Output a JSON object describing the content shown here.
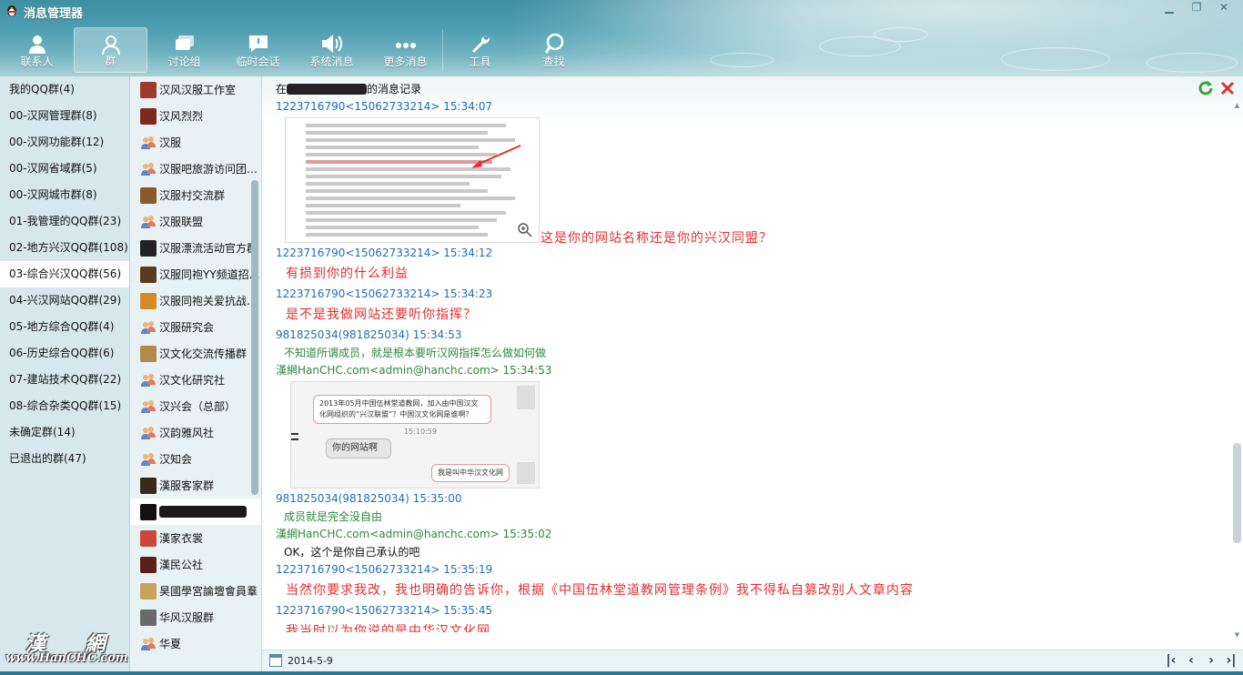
{
  "window": {
    "title": "消息管理器",
    "controls": [
      "minimize",
      "restore",
      "close"
    ]
  },
  "toolbar": [
    {
      "label": "联系人",
      "icon": "contact-icon"
    },
    {
      "label": "群",
      "icon": "group-icon",
      "active": true
    },
    {
      "label": "讨论组",
      "icon": "discussion-icon"
    },
    {
      "label": "临时会话",
      "icon": "temp-chat-icon"
    },
    {
      "label": "系统消息",
      "icon": "speaker-icon"
    },
    {
      "label": "更多消息",
      "icon": "more-icon"
    },
    {
      "label": "工具",
      "icon": "wrench-icon"
    },
    {
      "label": "查找",
      "icon": "search-icon"
    }
  ],
  "categories": [
    {
      "label": "我的QQ群(4)"
    },
    {
      "label": "00-汉网管理群(8)"
    },
    {
      "label": "00-汉网功能群(12)"
    },
    {
      "label": "00-汉网省域群(5)"
    },
    {
      "label": "00-汉网城市群(8)"
    },
    {
      "label": "01-我管理的QQ群(23)"
    },
    {
      "label": "02-地方兴汉QQ群(108)"
    },
    {
      "label": "03-综合兴汉QQ群(56)",
      "selected": true
    },
    {
      "label": "04-兴汉网站QQ群(29)"
    },
    {
      "label": "05-地方综合QQ群(4)"
    },
    {
      "label": "06-历史综合QQ群(6)"
    },
    {
      "label": "07-建站技术QQ群(22)"
    },
    {
      "label": "08-综合杂类QQ群(15)"
    },
    {
      "label": "未确定群(14)"
    },
    {
      "label": "已退出的群(47)"
    }
  ],
  "watermark": {
    "chars": "漢 網",
    "url": "www.HanCHC.com"
  },
  "groups": [
    {
      "name": "汉风汉服工作室",
      "icon": "avatar-a"
    },
    {
      "name": "汉风烈烈",
      "icon": "avatar-b"
    },
    {
      "name": "汉服",
      "icon": "people"
    },
    {
      "name": "汉服吧旅游访问团…",
      "icon": "people"
    },
    {
      "name": "汉服村交流群",
      "icon": "avatar-c"
    },
    {
      "name": "汉服联盟",
      "icon": "people"
    },
    {
      "name": "汉服漂流活动官方群",
      "icon": "avatar-d"
    },
    {
      "name": "汉服同袍YY频道招…",
      "icon": "avatar-e"
    },
    {
      "name": "汉服同袍关爱抗战…",
      "icon": "avatar-f"
    },
    {
      "name": "汉服研究会",
      "icon": "people"
    },
    {
      "name": "汉文化交流传播群",
      "icon": "avatar-g"
    },
    {
      "name": "汉文化研究社",
      "icon": "people"
    },
    {
      "name": "汉兴会（总部）",
      "icon": "people"
    },
    {
      "name": "汉韵雅风社",
      "icon": "people"
    },
    {
      "name": "汉知会",
      "icon": "people"
    },
    {
      "name": "漢服客家群",
      "icon": "avatar-h"
    },
    {
      "name": "",
      "icon": "avatar-i",
      "selected": true,
      "redacted": true
    },
    {
      "name": "漢家衣裳",
      "icon": "avatar-j"
    },
    {
      "name": "漢民公社",
      "icon": "avatar-k"
    },
    {
      "name": "昊國學宮論壇會員羣",
      "icon": "avatar-l"
    },
    {
      "name": "华风汉服群",
      "icon": "avatar-m"
    },
    {
      "name": "华夏",
      "icon": "people"
    }
  ],
  "record": {
    "prefix": "在",
    "suffix": "的消息记录"
  },
  "messages": {
    "m1_sender": "1223716790<15062733214> 15:34:07",
    "m1_caption": "这是你的网站名称还是你的兴汉同盟？",
    "m2_sender": "1223716790<15062733214> 15:34:12",
    "m2_body": "有损到你的什么利益",
    "m3_sender": "1223716790<15062733214> 15:34:23",
    "m3_body": "是不是我做网站还要听你指挥？",
    "m4_sender": "981825034(981825034) 15:34:53",
    "m4_body": "不知道所谓成员，就是根本要听汉网指挥怎么做如何做",
    "m5_sender": "漢網HanCHC.com<admin@hanchc.com> 15:34:53",
    "m5_img_bubble1": "2013年05月中国伍林堂道教网，加入由中国汉文化网组织的“兴汉联盟”？中国汉文化网是谁啊？",
    "m5_img_time": "15:10:59",
    "m5_img_bubble2": "你的网站啊",
    "m5_img_bubble3": "我是叫中华汉文化网",
    "m6_sender": "981825034(981825034) 15:35:00",
    "m6_body": "成员就是完全没自由",
    "m7_sender": "漢網HanCHC.com<admin@hanchc.com> 15:35:02",
    "m7_body": "OK，这个是你自己承认的吧",
    "m8_sender": "1223716790<15062733214> 15:35:19",
    "m8_body": "当然你要求我改，我也明确的告诉你，根据《中国伍林堂道教网管理条例》我不得私自篡改别人文章内容",
    "m9_sender": "1223716790<15062733214> 15:35:45",
    "m9_body": "我当时以为你说的是中华汉文化网"
  },
  "footer": {
    "date": "2014-5-9"
  },
  "colors": {
    "sender_blue": "#1e6fb8",
    "sender_green": "#2a8a3a",
    "red_text": "#e03030",
    "header_teal": "#4f9fb2"
  }
}
